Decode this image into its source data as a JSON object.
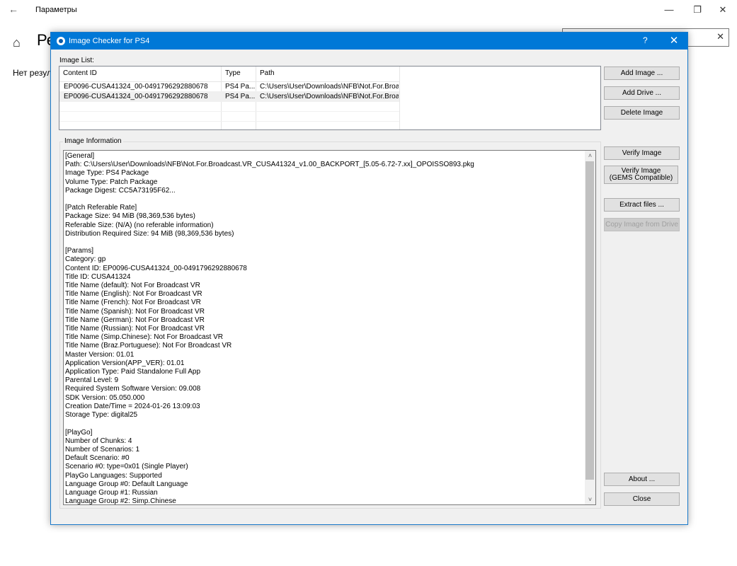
{
  "background_window": {
    "title": "Параметры",
    "back_glyph": "←",
    "home_glyph": "⌂",
    "heading_partial": "Ре",
    "no_results_partial": "Нет резуль",
    "search_clear_glyph": "✕",
    "minimize_glyph": "—",
    "restore_glyph": "❐",
    "close_glyph": "✕"
  },
  "dialog": {
    "title": "Image Checker for PS4",
    "help_glyph": "?",
    "close_glyph": "✕",
    "image_list_label": "Image List:",
    "columns": [
      "Content ID",
      "Type",
      "Path"
    ],
    "rows": [
      {
        "content_id": "EP0096-CUSA41324_00-0491796292880678",
        "type": "PS4 Pa...",
        "path": "C:\\Users\\User\\Downloads\\NFB\\Not.For.Broad..."
      },
      {
        "content_id": "EP0096-CUSA41324_00-0491796292880678",
        "type": "PS4 Pa...",
        "path": "C:\\Users\\User\\Downloads\\NFB\\Not.For.Broad..."
      }
    ],
    "image_info_label": "Image Information",
    "info_text": "[General]\nPath: C:\\Users\\User\\Downloads\\NFB\\Not.For.Broadcast.VR_CUSA41324_v1.00_BACKPORT_[5.05-6.72-7.xx]_OPOISSO893.pkg\nImage Type: PS4 Package\nVolume Type: Patch Package\nPackage Digest: CC5A73195F62...\n\n[Patch Referable Rate]\nPackage Size: 94 MiB (98,369,536 bytes)\nReferable Size: (N/A) (no referable information)\nDistribution Required Size: 94 MiB (98,369,536 bytes)\n\n[Params]\nCategory: gp\nContent ID: EP0096-CUSA41324_00-0491796292880678\nTitle ID: CUSA41324\nTitle Name (default): Not For Broadcast VR\nTitle Name (English): Not For Broadcast VR\nTitle Name (French): Not For Broadcast VR\nTitle Name (Spanish): Not For Broadcast VR\nTitle Name (German): Not For Broadcast VR\nTitle Name (Russian): Not For Broadcast VR\nTitle Name (Simp.Chinese): Not For Broadcast VR\nTitle Name (Braz.Portuguese): Not For Broadcast VR\nMaster Version: 01.01\nApplication Version(APP_VER): 01.01\nApplication Type: Paid Standalone Full App\nParental Level: 9\nRequired System Software Version: 09.008\nSDK Version: 05.050.000\nCreation Date/Time = 2024-01-26 13:09:03\nStorage Type: digital25\n\n[PlayGo]\nNumber of Chunks: 4\nNumber of Scenarios: 1\nDefault Scenario: #0\nScenario #0: type=0x01 (Single Player)\nPlayGo Languages: Supported\nLanguage Group #0: Default Language\nLanguage Group #1: Russian\nLanguage Group #2: Simp.Chinese",
    "buttons": {
      "add_image": "Add Image ...",
      "add_drive": "Add Drive ...",
      "delete_image": "Delete Image",
      "verify_image": "Verify Image",
      "verify_gems_line1": "Verify Image",
      "verify_gems_line2": "(GEMS Compatible)",
      "extract_files": "Extract files ...",
      "copy_from_drive": "Copy Image from Drive",
      "about": "About ...",
      "close": "Close"
    },
    "scroll_up_glyph": "˄",
    "scroll_down_glyph": "˅"
  }
}
